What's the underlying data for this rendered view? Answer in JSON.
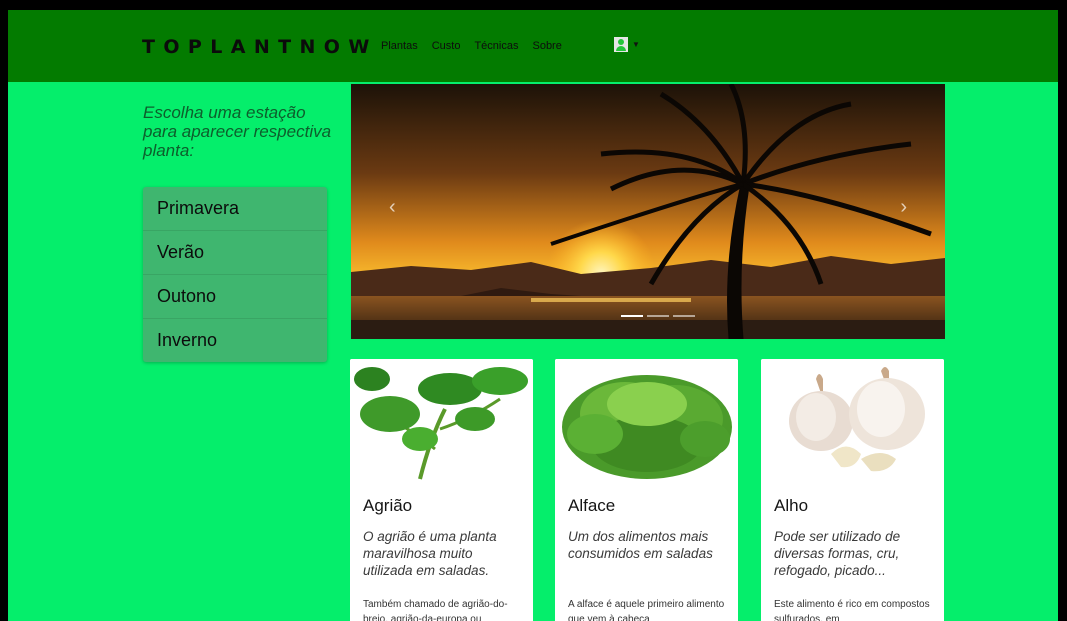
{
  "navbar": {
    "brand": "TOPLANTNOW",
    "links": [
      "Plantas",
      "Custo",
      "Técnicas",
      "Sobre"
    ],
    "user_icon": "user-icon",
    "caret_icon": "chevron-down-icon"
  },
  "sidebar": {
    "intro": "Escolha uma estação para aparecer respectiva planta:",
    "seasons": [
      "Primavera",
      "Verão",
      "Outono",
      "Inverno"
    ]
  },
  "carousel": {
    "prev_icon": "‹",
    "next_icon": "›",
    "indicator_count": 3,
    "active_indicator": 1
  },
  "cards": [
    {
      "title": "Agrião",
      "lead": "O agrião é uma planta maravilhosa muito utilizada em saladas.",
      "body": "Também chamado de agrião-do-brejo, agrião-da-europa ou"
    },
    {
      "title": "Alface",
      "lead": "Um dos alimentos mais consumidos em saladas",
      "body": "A alface é aquele primeiro alimento que vem à cabeça"
    },
    {
      "title": "Alho",
      "lead": "Pode ser utilizado de diversas formas, cru, refogado, picado...",
      "body": "Este alimento é rico em compostos sulfurados, em"
    }
  ],
  "colors": {
    "background": "#05ee6b",
    "navbar": "#037b00",
    "season_list": "#3fb66f"
  }
}
